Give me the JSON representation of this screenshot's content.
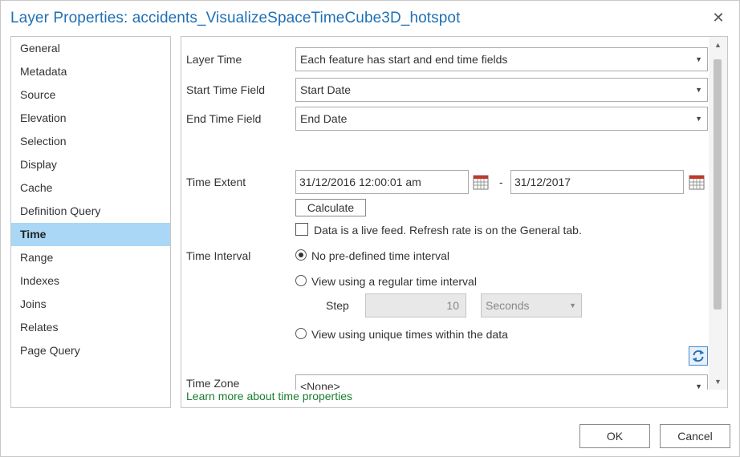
{
  "window": {
    "title": "Layer Properties: accidents_VisualizeSpaceTimeCube3D_hotspot"
  },
  "nav": {
    "items": [
      {
        "label": "General"
      },
      {
        "label": "Metadata"
      },
      {
        "label": "Source"
      },
      {
        "label": "Elevation"
      },
      {
        "label": "Selection"
      },
      {
        "label": "Display"
      },
      {
        "label": "Cache"
      },
      {
        "label": "Definition Query"
      },
      {
        "label": "Time"
      },
      {
        "label": "Range"
      },
      {
        "label": "Indexes"
      },
      {
        "label": "Joins"
      },
      {
        "label": "Relates"
      },
      {
        "label": "Page Query"
      }
    ],
    "active": "Time"
  },
  "time": {
    "layer_time_label": "Layer Time",
    "layer_time_value": "Each feature has start and end time fields",
    "start_field_label": "Start Time Field",
    "start_field_value": "Start Date",
    "end_field_label": "End Time Field",
    "end_field_value": "End Date",
    "extent_label": "Time Extent",
    "extent_start": "31/12/2016 12:00:01 am",
    "extent_separator": "-",
    "extent_end": "31/12/2017",
    "calculate_label": "Calculate",
    "live_feed_label": "Data is a live feed. Refresh rate is on the General tab.",
    "interval_label": "Time Interval",
    "interval_options": [
      {
        "label": "No pre-defined time interval",
        "selected": true
      },
      {
        "label": "View using a regular time interval",
        "selected": false
      },
      {
        "label": "View using unique times within the data",
        "selected": false
      }
    ],
    "step_label": "Step",
    "step_value": "10",
    "step_unit": "Seconds",
    "timezone_label": "Time Zone",
    "timezone_value": "<None>",
    "learn_more": "Learn more about time properties"
  },
  "footer": {
    "ok_label": "OK",
    "cancel_label": "Cancel"
  },
  "icons": {
    "close": "close-icon",
    "calendar": "calendar-icon",
    "refresh": "refresh-icon",
    "dropdown": "chevron-down-icon"
  },
  "colors": {
    "title": "#1f6fb5",
    "active_nav": "#a9d7f5",
    "link": "#1a7c2e"
  }
}
